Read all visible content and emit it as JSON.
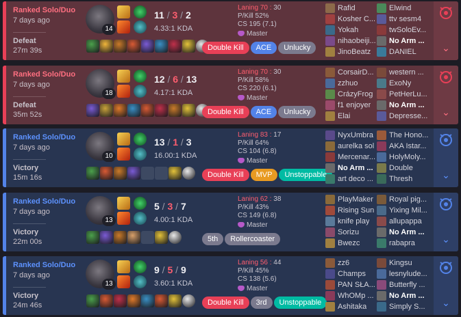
{
  "icons": {
    "track": "tracking-icon",
    "expand": "chevron-down-icon",
    "rank": "master-emblem-icon"
  },
  "colors": {
    "loss_bg": "#5e343d",
    "win_bg": "#283551",
    "loss_accent": "#e84057",
    "win_accent": "#5383e8"
  },
  "matches": [
    {
      "result_type": "loss",
      "queue": "Ranked Solo/Duo",
      "ago": "7 days ago",
      "result": "Defeat",
      "duration": "27m 39s",
      "level": "14",
      "kills": "11",
      "deaths": "3",
      "assists": "2",
      "kda": "4.33:1 KDA",
      "laning_label": "Laning",
      "laning": "70",
      "laning_opp": "30",
      "pkill": "P/Kill 52%",
      "cs": "CS 195 (7.1)",
      "rank": "Master",
      "items": [
        "#4ba04b",
        "#f0b53a",
        "#c97a2a",
        "#d85a34",
        "#7a5bd4",
        "#3a8fc4",
        "#c0304a",
        "#e3c23a",
        "#e8e8e8"
      ],
      "badges": [
        {
          "text": "Double Kill",
          "c": "red"
        },
        {
          "text": "ACE",
          "c": "blue"
        },
        {
          "text": "Unlucky",
          "c": "grey"
        }
      ],
      "team1": [
        {
          "n": "Rafid",
          "c": "#8c6a4a"
        },
        {
          "n": "Kosher C...",
          "c": "#a04040"
        },
        {
          "n": "Yokah",
          "c": "#3a6a8a"
        },
        {
          "n": "nihaobeiji...",
          "c": "#7a4a8a"
        },
        {
          "n": "JinoBeatz",
          "c": "#a08040"
        }
      ],
      "team2": [
        {
          "n": "Elwind",
          "c": "#4a8a5a"
        },
        {
          "n": "ttv sesm4",
          "c": "#5a5a9a"
        },
        {
          "n": "twSoloEv...",
          "c": "#8a3a3a"
        },
        {
          "n": "No Arm ...",
          "c": "#6a6a6a",
          "me": true
        },
        {
          "n": "DANIEL",
          "c": "#3a7a9a"
        }
      ]
    },
    {
      "result_type": "loss",
      "queue": "Ranked Solo/Duo",
      "ago": "7 days ago",
      "result": "Defeat",
      "duration": "35m 52s",
      "level": "18",
      "kills": "12",
      "deaths": "6",
      "assists": "13",
      "kda": "4.17:1 KDA",
      "laning_label": "Laning",
      "laning": "70",
      "laning_opp": "30",
      "pkill": "P/Kill 58%",
      "cs": "CS 220 (6.1)",
      "rank": "Master",
      "items": [
        "#7a5bd4",
        "#c9a23a",
        "#e07a2a",
        "#3a8fc4",
        "#d85a34",
        "#c0304a",
        "#c97a2a",
        "#e3c23a",
        "#e8e8e8"
      ],
      "badges": [
        {
          "text": "Double Kill",
          "c": "red"
        },
        {
          "text": "ACE",
          "c": "blue"
        },
        {
          "text": "Unlucky",
          "c": "grey"
        }
      ],
      "team1": [
        {
          "n": "CorsairD...",
          "c": "#8a5a3a"
        },
        {
          "n": "zzhuo",
          "c": "#4a6a9a"
        },
        {
          "n": "CrázyFrog",
          "c": "#5a8a4a"
        },
        {
          "n": "f1 enjoyer",
          "c": "#9a4a6a"
        },
        {
          "n": "Elai",
          "c": "#a08040"
        }
      ],
      "team2": [
        {
          "n": "western ...",
          "c": "#7a4a3a"
        },
        {
          "n": "ExoNy",
          "c": "#4a7a8a"
        },
        {
          "n": "PetHerLu...",
          "c": "#8a4a4a"
        },
        {
          "n": "No Arm ...",
          "c": "#6a6a6a",
          "me": true
        },
        {
          "n": "Depresse...",
          "c": "#5a5a9a"
        }
      ]
    },
    {
      "result_type": "win",
      "queue": "Ranked Solo/Duo",
      "ago": "7 days ago",
      "result": "Victory",
      "duration": "15m 16s",
      "level": "10",
      "kills": "13",
      "deaths": "1",
      "assists": "3",
      "kda": "16.00:1 KDA",
      "laning_label": "Laning",
      "laning": "83",
      "laning_opp": "17",
      "pkill": "P/Kill 64%",
      "cs": "CS 104 (6.8)",
      "rank": "Master",
      "items": [
        "#4ba04b",
        "#d85a34",
        "#c97a2a",
        "#7a5bd4",
        "empty",
        "empty",
        "#e3c23a",
        "#e8e8e8"
      ],
      "badges": [
        {
          "text": "Double Kill",
          "c": "red"
        },
        {
          "text": "MVP",
          "c": "orange"
        },
        {
          "text": "Unstoppable",
          "c": "green"
        }
      ],
      "team1": [
        {
          "n": "NyxUmbra",
          "c": "#5a4a8a"
        },
        {
          "n": "aurelka sol",
          "c": "#8a6a3a"
        },
        {
          "n": "Mercenar...",
          "c": "#8a3a3a"
        },
        {
          "n": "No Arm ...",
          "c": "#6a6a6a",
          "me": true
        },
        {
          "n": "art deco ...",
          "c": "#3a7a6a"
        }
      ],
      "team2": [
        {
          "n": "The Hono...",
          "c": "#9a5a3a"
        },
        {
          "n": "AKA Istar...",
          "c": "#8a3a5a"
        },
        {
          "n": "HolyMoly...",
          "c": "#4a6a9a"
        },
        {
          "n": "Double",
          "c": "#7a7a4a"
        },
        {
          "n": "Thresh",
          "c": "#3a6a5a"
        }
      ]
    },
    {
      "result_type": "win",
      "queue": "Ranked Solo/Duo",
      "ago": "7 days ago",
      "result": "Victory",
      "duration": "22m 00s",
      "level": "13",
      "kills": "5",
      "deaths": "3",
      "assists": "7",
      "kda": "4.00:1 KDA",
      "laning_label": "Laning",
      "laning": "62",
      "laning_opp": "38",
      "pkill": "P/Kill 43%",
      "cs": "CS 149 (6.8)",
      "rank": "Master",
      "items": [
        "#4ba04b",
        "#7a5bd4",
        "#c97a2a",
        "#d8a06a",
        "empty",
        "#e3c23a",
        "#e8e8e8"
      ],
      "badges": [
        {
          "text": "5th",
          "c": "grey"
        },
        {
          "text": "Rollercoaster",
          "c": "grey"
        }
      ],
      "team1": [
        {
          "n": "PlayMaker",
          "c": "#8a6a3a"
        },
        {
          "n": "Rising Sun",
          "c": "#a04a3a"
        },
        {
          "n": "knife play",
          "c": "#5a7a9a"
        },
        {
          "n": "Sorizu",
          "c": "#8a4a6a"
        },
        {
          "n": "Bwezc",
          "c": "#a08040"
        }
      ],
      "team2": [
        {
          "n": "Royal pig...",
          "c": "#7a5a3a"
        },
        {
          "n": "Yixing Mil...",
          "c": "#4a6a8a"
        },
        {
          "n": "allupappa",
          "c": "#8a4a4a"
        },
        {
          "n": "No Arm ...",
          "c": "#6a6a6a",
          "me": true
        },
        {
          "n": "rabapra",
          "c": "#3a7a6a"
        }
      ]
    },
    {
      "result_type": "win",
      "queue": "Ranked Solo/Duo",
      "ago": "7 days ago",
      "result": "Victory",
      "duration": "24m 46s",
      "level": "13",
      "kills": "9",
      "deaths": "5",
      "assists": "9",
      "kda": "3.60:1 KDA",
      "laning_label": "Laning",
      "laning": "56",
      "laning_opp": "44",
      "pkill": "P/Kill 45%",
      "cs": "CS 138 (5.6)",
      "rank": "Master",
      "items": [
        "#4ba04b",
        "#d85a34",
        "#c0304a",
        "#e07a2a",
        "#3a8fc4",
        "#d85a34",
        "#e3c23a",
        "#e8e8e8"
      ],
      "badges": [
        {
          "text": "Double Kill",
          "c": "red"
        },
        {
          "text": "3rd",
          "c": "grey"
        },
        {
          "text": "Unstoppable",
          "c": "green"
        }
      ],
      "team1": [
        {
          "n": "zz6",
          "c": "#8a5a3a"
        },
        {
          "n": "Champs",
          "c": "#4a4a8a"
        },
        {
          "n": "PAN SŁA...",
          "c": "#9a4a3a"
        },
        {
          "n": "WhOMp ...",
          "c": "#8a3a5a"
        },
        {
          "n": "Ashitaka",
          "c": "#a08040"
        }
      ],
      "team2": [
        {
          "n": "Kingsu",
          "c": "#7a4a3a"
        },
        {
          "n": "lesnylude...",
          "c": "#4a6a9a"
        },
        {
          "n": "Butterfly ...",
          "c": "#8a4a7a"
        },
        {
          "n": "No Arm ...",
          "c": "#6a6a6a",
          "me": true
        },
        {
          "n": "Simply S...",
          "c": "#3a6a8a"
        }
      ]
    }
  ]
}
